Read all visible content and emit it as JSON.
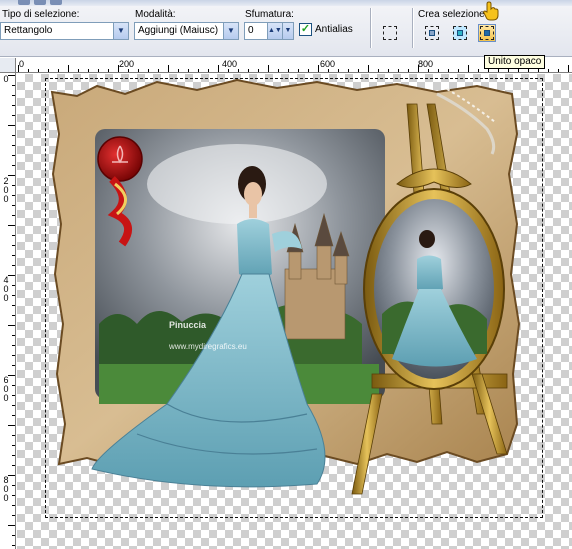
{
  "toolbar": {
    "selection_type_label": "Tipo di selezione:",
    "selection_type_value": "Rettangolo",
    "mode_label": "Modalità:",
    "mode_value": "Aggiungi (Maiusc)",
    "feather_label": "Sfumatura:",
    "feather_value": "0",
    "antialias_label": "Antialias",
    "antialias_checked": true,
    "create_selection_label": "Crea selezione d",
    "tooltip": "Unito opaco"
  },
  "ruler": {
    "h_labels": [
      "0",
      "200",
      "400",
      "600",
      "800"
    ],
    "v_labels": [
      [
        "0"
      ],
      [
        "2",
        "0",
        "0"
      ],
      [
        "4",
        "0",
        "0"
      ],
      [
        "6",
        "0",
        "0"
      ],
      [
        "8",
        "0",
        "0"
      ]
    ]
  },
  "image": {
    "watermark_line1": "Pinuccia",
    "watermark_line2": "www.mydiregrafics.eu"
  },
  "colors": {
    "accent": "#f2c24a",
    "selection_border": "#7f9db9"
  }
}
